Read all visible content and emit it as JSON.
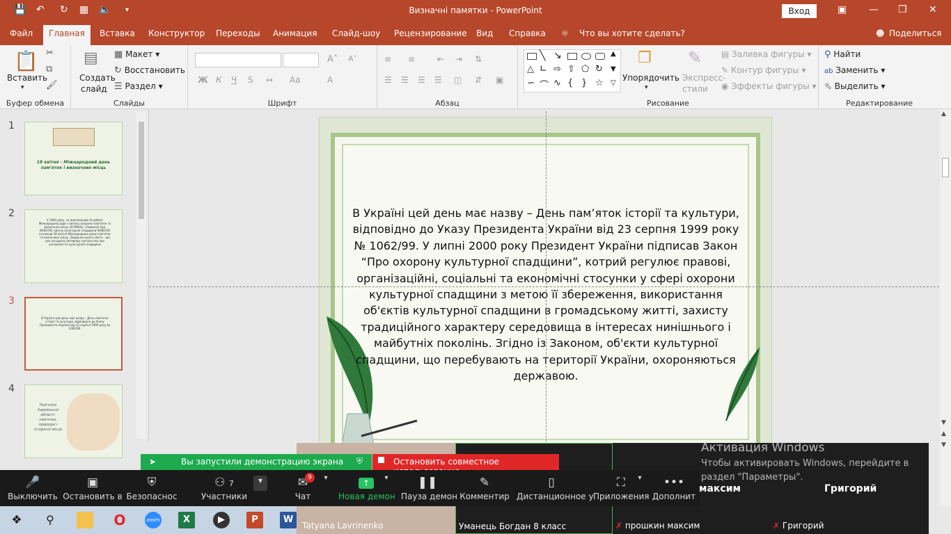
{
  "titlebar": {
    "title": "Визначні памятки  -  PowerPoint",
    "login_label": "Вход",
    "icons": [
      "save-icon",
      "undo-icon",
      "redo-icon",
      "slideshow-icon",
      "sound-icon",
      "customize-icon"
    ]
  },
  "tabs": [
    {
      "label": "Файл"
    },
    {
      "label": "Главная"
    },
    {
      "label": "Вставка"
    },
    {
      "label": "Конструктор"
    },
    {
      "label": "Переходы"
    },
    {
      "label": "Анимация"
    },
    {
      "label": "Слайд-шоу"
    },
    {
      "label": "Рецензирование"
    },
    {
      "label": "Вид"
    },
    {
      "label": "Справка"
    },
    {
      "label": "Что вы хотите сделать?"
    },
    {
      "label": "Поделиться"
    }
  ],
  "ribbon": {
    "clipboard": {
      "paste": "Вставить",
      "group": "Буфер обмена"
    },
    "slides": {
      "new_slide_1": "Создать",
      "new_slide_2": "слайд",
      "layout": "Макет",
      "reset": "Восстановить",
      "section": "Раздел",
      "group": "Слайды"
    },
    "font": {
      "bold": "Ж",
      "italic": "К",
      "underline": "Ч",
      "strike": "S",
      "group": "Шрифт"
    },
    "paragraph": {
      "group": "Абзац"
    },
    "drawing": {
      "arrange_1": "Упорядочить",
      "styles_1": "Экспресс-",
      "styles_2": "стили",
      "fill": "Заливка фигуры",
      "outline": "Контур фигуры",
      "effects": "Эффекты фигуры",
      "group": "Рисование"
    },
    "editing": {
      "find": "Найти",
      "replace": "Заменить",
      "select": "Выделить",
      "group": "Редактирование"
    }
  },
  "slides_panel": [
    {
      "number": "1",
      "text": "18 квітня - Міжнародний день пам'яток і визначних місць"
    },
    {
      "number": "2",
      "text": "У 1983 року, за пропозицією Асамблеї Міжнародної ради з питань охорони пам'яток та визначних місць (ICOMOS), створеної при ЮНЕСКО, Центр культурної спадщини ЮНЕСКО оголосив 18 квітня Міжнародним днем пам'яток та визначних місць. Завдання цього свята – ще раз нагадати світовому суспільству про різноманіття культурної спадщини"
    },
    {
      "number": "3",
      "text": "В Україні цей день має назву – День пам'яток історії та культури, відповідно до Указу Президента України від 23 серпня 1999 року № 1062/99."
    },
    {
      "number": "4",
      "text": "Пам'ятки Харківської області: пам'ятки, природні і історичні місця"
    }
  ],
  "slide": {
    "text": "В Україні цей день має назву – День пам’яток історії та культури, відповідно до Указу Президента України від 23 серпня 1999 року № 1062/99. У липні 2000 року Президент України підписав Закон “Про охорону культурної спадщини”, котрий регулює правові, організаційні, соціальні та економічні стосунки у сфері охорони культурної спадщини з метою її збереження, використання об'єктів культурної спадщини в громадському житті, захисту традиційного характеру середовища в інтересах нинішнього і майбутніх поколінь. Згідно із Законом, об'єкти культурної спадщини, що перебувають на території України, охороняються державою."
  },
  "zoom": {
    "share_notice": "Вы запустили демонстрацию экрана",
    "stop_share": "Остановить совместное использование",
    "participants_count": "7",
    "chat_badge": "9",
    "buttons": [
      {
        "label": "Выключить"
      },
      {
        "label": "Остановить в"
      },
      {
        "label": "Безопаснос"
      },
      {
        "label": "Участники"
      },
      {
        "label": "Чат"
      },
      {
        "label": "Новая демон"
      },
      {
        "label": "Пауза демон"
      },
      {
        "label": "Комментир"
      },
      {
        "label": "Дистанционное у"
      },
      {
        "label": "Приложения"
      },
      {
        "label": "Дополнит"
      }
    ],
    "participants": [
      {
        "name": "Tatyana Lavrinenko"
      },
      {
        "name": "Уманець Богдан 8 класс"
      },
      {
        "name": "прошкин максим",
        "big": "максим"
      },
      {
        "name": "Григорий",
        "big": "Григорий"
      }
    ]
  },
  "activation": {
    "title": "Активация Windows",
    "body": "Чтобы активировать Windows, перейдите в раздел \"Параметры\"."
  },
  "colors": {
    "accent": "#b7472a",
    "zoom_green": "#1eaa4e",
    "zoom_red": "#e02727"
  }
}
